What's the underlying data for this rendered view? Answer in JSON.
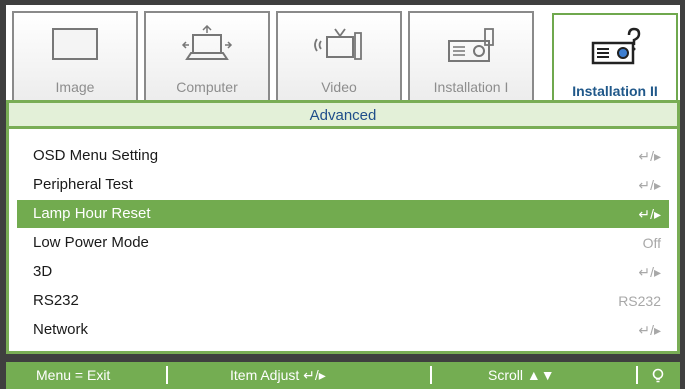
{
  "tabs": [
    {
      "label": "Image",
      "icon": "image-icon",
      "active": false
    },
    {
      "label": "Computer",
      "icon": "computer-icon",
      "active": false
    },
    {
      "label": "Video",
      "icon": "video-icon",
      "active": false
    },
    {
      "label": "Installation I",
      "icon": "projector-icon",
      "active": false
    },
    {
      "label": "Installation II",
      "icon": "projector-settings-icon",
      "active": true
    }
  ],
  "section": {
    "title": "Advanced"
  },
  "items": [
    {
      "name": "OSD Menu Setting",
      "value": "↵/▸"
    },
    {
      "name": "Peripheral Test",
      "value": "↵/▸"
    },
    {
      "name": "Lamp Hour Reset",
      "value": "↵/▸",
      "selected": true
    },
    {
      "name": "Low Power Mode",
      "value": "Off"
    },
    {
      "name": "3D",
      "value": "↵/▸"
    },
    {
      "name": "RS232",
      "value": "RS232"
    },
    {
      "name": "Network",
      "value": "↵/▸"
    }
  ],
  "footer": {
    "menu": "Menu = Exit",
    "adjust": "Item Adjust ↵/▸",
    "scroll": "Scroll ▲▼",
    "icon": "lamp-icon"
  },
  "colors": {
    "accent": "#74ad52",
    "header_text": "#1f4e8a",
    "background": "#3f3f3f"
  }
}
